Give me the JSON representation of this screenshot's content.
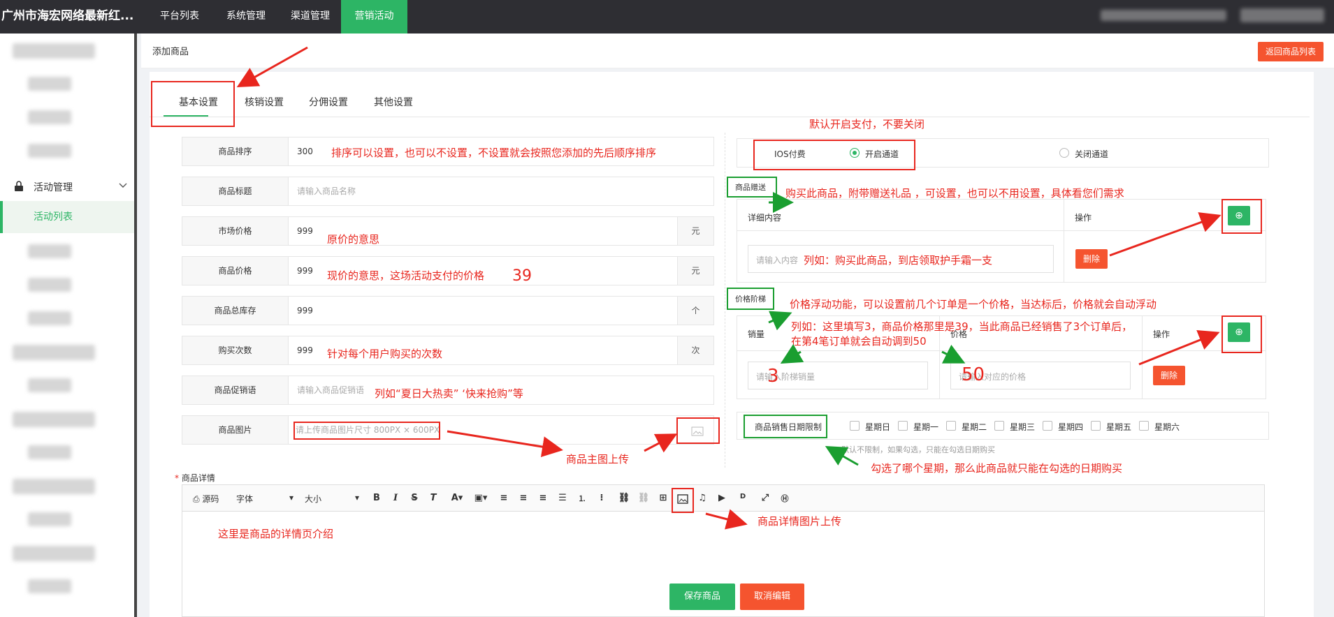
{
  "header": {
    "brand": "广州市海宏网络最新红...",
    "nav": [
      {
        "label": "平台列表"
      },
      {
        "label": "系统管理"
      },
      {
        "label": "渠道管理"
      },
      {
        "label": "营销活动"
      }
    ]
  },
  "sidebar": {
    "group": "活动管理",
    "active_item": "活动列表"
  },
  "breadcrumb": "添加商品",
  "back_button": "返回商品列表",
  "tabs": [
    {
      "label": "基本设置"
    },
    {
      "label": "核销设置"
    },
    {
      "label": "分佣设置"
    },
    {
      "label": "其他设置"
    }
  ],
  "form": {
    "sort": {
      "label": "商品排序",
      "value": "300"
    },
    "title": {
      "label": "商品标题",
      "placeholder": "请输入商品名称"
    },
    "market_price": {
      "label": "市场价格",
      "value": "999",
      "unit": "元"
    },
    "price": {
      "label": "商品价格",
      "value": "999",
      "unit": "元"
    },
    "stock": {
      "label": "商品总库存",
      "value": "999",
      "unit": "个"
    },
    "buy_times": {
      "label": "购买次数",
      "value": "999",
      "unit": "次"
    },
    "promo": {
      "label": "商品促销语",
      "placeholder": "请输入商品促销语"
    },
    "image": {
      "label": "商品图片",
      "placeholder": "请上传商品图片尺寸 800PX × 600PX"
    }
  },
  "ios_pay": {
    "label": "IOS付费",
    "open": "开启通道",
    "close": "关闭通道"
  },
  "gift": {
    "tag": "商品赠送",
    "col_detail": "详细内容",
    "col_op": "操作",
    "placeholder": "请输入内容",
    "delete": "删除"
  },
  "tier": {
    "tag": "价格阶梯",
    "col_sales": "销量",
    "col_price": "价格",
    "col_op": "操作",
    "ph_sales": "请输入阶梯销量",
    "ph_price": "请输入对应的价格",
    "delete": "删除"
  },
  "date_limit": {
    "label": "商品销售日期限制",
    "days": [
      "星期日",
      "星期一",
      "星期二",
      "星期三",
      "星期四",
      "星期五",
      "星期六"
    ],
    "hint": "默认不限制，如果勾选，只能在勾选日期购买"
  },
  "detail": {
    "label": "商品详情",
    "required_mark": "*",
    "source": "源码",
    "font": "字体",
    "size": "大小"
  },
  "footer": {
    "save": "保存商品",
    "cancel": "取消编辑"
  },
  "annotations": {
    "pay_default": "默认开启支付，不要关闭",
    "sort": "排序可以设置，也可以不设置，不设置就会按照您添加的先后顺序排序",
    "gift": "购买此商品，附带赠送礼品 ，可设置，也可以不用设置，具体看您们需求",
    "gift_example": "列如：购买此商品，到店领取护手霜一支",
    "market": "原价的意思",
    "price": "现价的意思，这场活动支付的价格",
    "price_num": "39",
    "tier": "价格浮动功能，可以设置前几个订单是一个价格，当达标后，价格就会自动浮动",
    "tier_ex1": "列如：这里填写3，商品价格那里是39，当此商品已经销售了3个订单后，",
    "tier_ex2": "在第4笔订单就会自动调到50",
    "tier_3": "3",
    "tier_50": "50",
    "buy": "针对每个用户购买的次数",
    "promo_ex": "列如“夏日大热卖”    ‘快来抢购”等",
    "main_img": "商品主图上传",
    "week": "勾选了哪个星期，那么此商品就只能在勾选的日期购买",
    "detail_img": "商品详情图片上传",
    "detail_intro": "这里是商品的详情页介绍"
  },
  "colors": {
    "accent": "#2db565",
    "danger": "#f5542f",
    "annotation": "#e8261e",
    "topbar": "#2e2e33"
  }
}
